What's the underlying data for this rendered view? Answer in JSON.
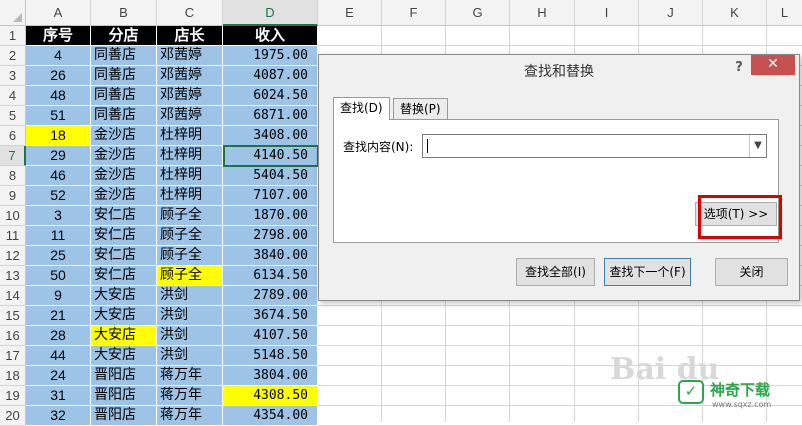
{
  "columns": [
    "A",
    "B",
    "C",
    "D",
    "E",
    "F",
    "G",
    "H",
    "I",
    "J",
    "K",
    "L"
  ],
  "selected_column": "D",
  "selected_row": "7",
  "header_row": {
    "row": "1",
    "cells": [
      "序号",
      "分店",
      "店长",
      "收入"
    ]
  },
  "rows": [
    {
      "row": "2",
      "id": "4",
      "store": "同善店",
      "manager": "邓茜婷",
      "income": "1975.00"
    },
    {
      "row": "3",
      "id": "26",
      "store": "同善店",
      "manager": "邓茜婷",
      "income": "4087.00"
    },
    {
      "row": "4",
      "id": "48",
      "store": "同善店",
      "manager": "邓茜婷",
      "income": "6024.50"
    },
    {
      "row": "5",
      "id": "51",
      "store": "同善店",
      "manager": "邓茜婷",
      "income": "6871.00"
    },
    {
      "row": "6",
      "id": "18",
      "store": "金沙店",
      "manager": "杜梓明",
      "income": "3408.00",
      "hl": "id"
    },
    {
      "row": "7",
      "id": "29",
      "store": "金沙店",
      "manager": "杜梓明",
      "income": "4140.50"
    },
    {
      "row": "8",
      "id": "46",
      "store": "金沙店",
      "manager": "杜梓明",
      "income": "5404.50"
    },
    {
      "row": "9",
      "id": "52",
      "store": "金沙店",
      "manager": "杜梓明",
      "income": "7107.00"
    },
    {
      "row": "10",
      "id": "3",
      "store": "安仁店",
      "manager": "顾子全",
      "income": "1870.00"
    },
    {
      "row": "11",
      "id": "11",
      "store": "安仁店",
      "manager": "顾子全",
      "income": "2798.00"
    },
    {
      "row": "12",
      "id": "25",
      "store": "安仁店",
      "manager": "顾子全",
      "income": "3840.00"
    },
    {
      "row": "13",
      "id": "50",
      "store": "安仁店",
      "manager": "顾子全",
      "income": "6134.50",
      "hl": "manager"
    },
    {
      "row": "14",
      "id": "9",
      "store": "大安店",
      "manager": "洪剑",
      "income": "2789.00"
    },
    {
      "row": "15",
      "id": "21",
      "store": "大安店",
      "manager": "洪剑",
      "income": "3674.50"
    },
    {
      "row": "16",
      "id": "28",
      "store": "大安店",
      "manager": "洪剑",
      "income": "4107.50",
      "hl": "store"
    },
    {
      "row": "17",
      "id": "44",
      "store": "大安店",
      "manager": "洪剑",
      "income": "5148.50"
    },
    {
      "row": "18",
      "id": "24",
      "store": "晋阳店",
      "manager": "蒋万年",
      "income": "3804.00"
    },
    {
      "row": "19",
      "id": "31",
      "store": "晋阳店",
      "manager": "蒋万年",
      "income": "4308.50",
      "hl": "income"
    },
    {
      "row": "20",
      "id": "32",
      "store": "晋阳店",
      "manager": "蒋万年",
      "income": "4354.00"
    }
  ],
  "highlight_color": "#ffff00",
  "accent_color": "#217346",
  "dialog": {
    "title": "查找和替换",
    "help": "?",
    "close_symbol": "✕",
    "tabs": [
      "查找(D)",
      "替换(P)"
    ],
    "find_label": "查找内容(N):",
    "find_value": "",
    "dropdown_icon": "chevron-down-icon",
    "options_label": "选项(T) >>",
    "buttons": {
      "find_all": "查找全部(I)",
      "find_next": "查找下一个(F)",
      "close": "关闭"
    }
  },
  "watermarks": {
    "baidu": "Bai du",
    "logo_text": "神奇下载",
    "logo_url": "www.sqxz.com"
  }
}
